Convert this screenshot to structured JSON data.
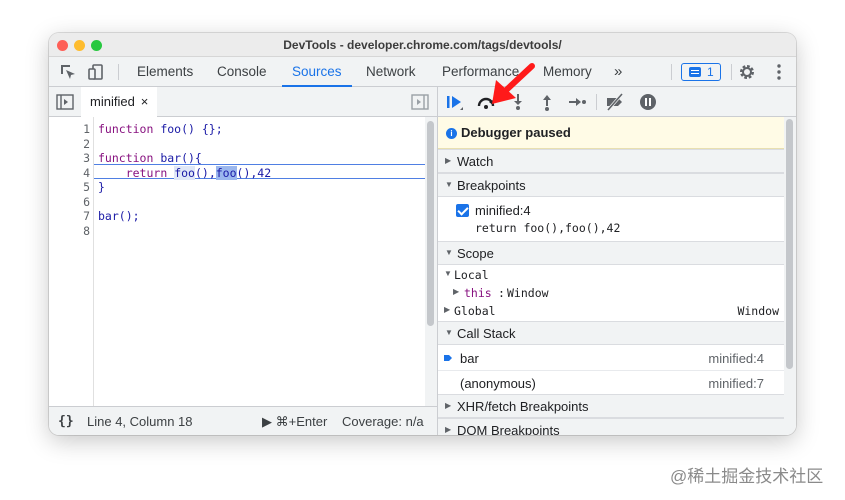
{
  "window": {
    "title": "DevTools - developer.chrome.com/tags/devtools/"
  },
  "tabs": [
    {
      "label": "Elements"
    },
    {
      "label": "Console"
    },
    {
      "label": "Sources"
    },
    {
      "label": "Network"
    },
    {
      "label": "Performance"
    },
    {
      "label": "Memory"
    }
  ],
  "more_tabs": "»",
  "issues_count": "1",
  "editor": {
    "file_tab": "minified",
    "close_glyph": "×",
    "lines": [
      {
        "n": "1",
        "text": "function foo() {};"
      },
      {
        "n": "2",
        "text": ""
      },
      {
        "n": "3",
        "text": "function bar(){"
      },
      {
        "n": "4",
        "text": "    return foo(),foo(),42"
      },
      {
        "n": "5",
        "text": "}"
      },
      {
        "n": "6",
        "text": ""
      },
      {
        "n": "7",
        "text": "bar();"
      },
      {
        "n": "8",
        "text": ""
      }
    ]
  },
  "status": {
    "braces": "{}",
    "position": "Line 4, Column 18",
    "run": "▶ ⌘+Enter",
    "coverage": "Coverage: n/a"
  },
  "debugger": {
    "paused_message": "Debugger paused",
    "watch": "Watch",
    "breakpoints": "Breakpoints",
    "breakpoint_location": "minified:4",
    "breakpoint_code": "return foo(),foo(),42",
    "scope": "Scope",
    "local": "Local",
    "this_key": "this",
    "this_value": "Window",
    "global": "Global",
    "global_value": "Window",
    "call_stack": "Call Stack",
    "frames": [
      {
        "name": "bar",
        "location": "minified:4"
      },
      {
        "name": "(anonymous)",
        "location": "minified:7"
      }
    ],
    "xhr": "XHR/fetch Breakpoints",
    "dom": "DOM Breakpoints"
  },
  "colors": {
    "accent": "#1a73e8",
    "paused_bg": "#fffbe6",
    "annotation_arrow": "#ff1a1a"
  },
  "watermark": "@稀土掘金技术社区"
}
